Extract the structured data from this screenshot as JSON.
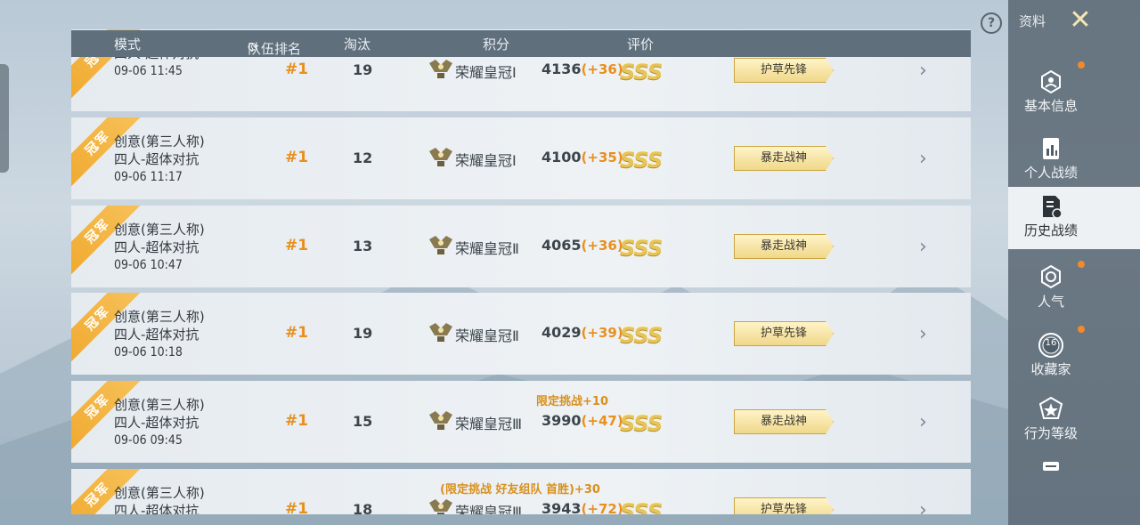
{
  "header": {
    "mode": "模式",
    "team_rank": "队伍排名",
    "kills": "淘汰",
    "score": "积分",
    "rating": "评价"
  },
  "rows": [
    {
      "ribbon": "冠军",
      "mode_line1": "",
      "mode_line2": "四人-超体对抗",
      "date": "09-06 11:45",
      "rank": "#1",
      "kills": "19",
      "tier": "荣耀皇冠Ⅰ",
      "score": "4136",
      "delta": "(+36)",
      "bonus": "",
      "grade": "SSS",
      "badge": "护草先锋"
    },
    {
      "ribbon": "冠军",
      "mode_line1": "创意(第三人称)",
      "mode_line2": "四人-超体对抗",
      "date": "09-06 11:17",
      "rank": "#1",
      "kills": "12",
      "tier": "荣耀皇冠Ⅰ",
      "score": "4100",
      "delta": "(+35)",
      "bonus": "",
      "grade": "SSS",
      "badge": "暴走战神"
    },
    {
      "ribbon": "冠军",
      "mode_line1": "创意(第三人称)",
      "mode_line2": "四人-超体对抗",
      "date": "09-06 10:47",
      "rank": "#1",
      "kills": "13",
      "tier": "荣耀皇冠Ⅱ",
      "score": "4065",
      "delta": "(+36)",
      "bonus": "",
      "grade": "SSS",
      "badge": "暴走战神"
    },
    {
      "ribbon": "冠军",
      "mode_line1": "创意(第三人称)",
      "mode_line2": "四人-超体对抗",
      "date": "09-06 10:18",
      "rank": "#1",
      "kills": "19",
      "tier": "荣耀皇冠Ⅱ",
      "score": "4029",
      "delta": "(+39)",
      "bonus": "",
      "grade": "SSS",
      "badge": "护草先锋"
    },
    {
      "ribbon": "冠军",
      "mode_line1": "创意(第三人称)",
      "mode_line2": "四人-超体对抗",
      "date": "09-06 09:45",
      "rank": "#1",
      "kills": "15",
      "tier": "荣耀皇冠Ⅲ",
      "score": "3990",
      "delta": "(+47)",
      "bonus": "限定挑战+10",
      "grade": "SSS",
      "badge": "暴走战神"
    },
    {
      "ribbon": "冠军",
      "mode_line1": "创意(第三人称)",
      "mode_line2": "四人-超体对抗",
      "date": "",
      "rank": "#1",
      "kills": "18",
      "tier": "荣耀皇冠Ⅲ",
      "score": "3943",
      "delta": "(+72)",
      "bonus": "(限定挑战 好友组队 首胜)+30",
      "grade": "SSS",
      "badge": "护草先锋"
    }
  ],
  "sidebar": {
    "title": "资料",
    "close_icon": "close-icon",
    "items": [
      {
        "label": "基本信息",
        "icon": "profile-icon",
        "dot": true,
        "active": false
      },
      {
        "label": "个人战绩",
        "icon": "stats-icon",
        "dot": false,
        "active": false
      },
      {
        "label": "历史战绩",
        "icon": "history-icon",
        "dot": false,
        "active": true
      },
      {
        "label": "人气",
        "icon": "popularity-icon",
        "dot": true,
        "active": false
      },
      {
        "label": "收藏家",
        "icon": "collector-icon",
        "dot": true,
        "active": false,
        "level": "16"
      },
      {
        "label": "行为等级",
        "icon": "behavior-icon",
        "dot": false,
        "active": false
      }
    ]
  },
  "colors": {
    "accent": "#e8901e",
    "sidebar_bg": "#505e69",
    "dot": "#f08a2a"
  }
}
